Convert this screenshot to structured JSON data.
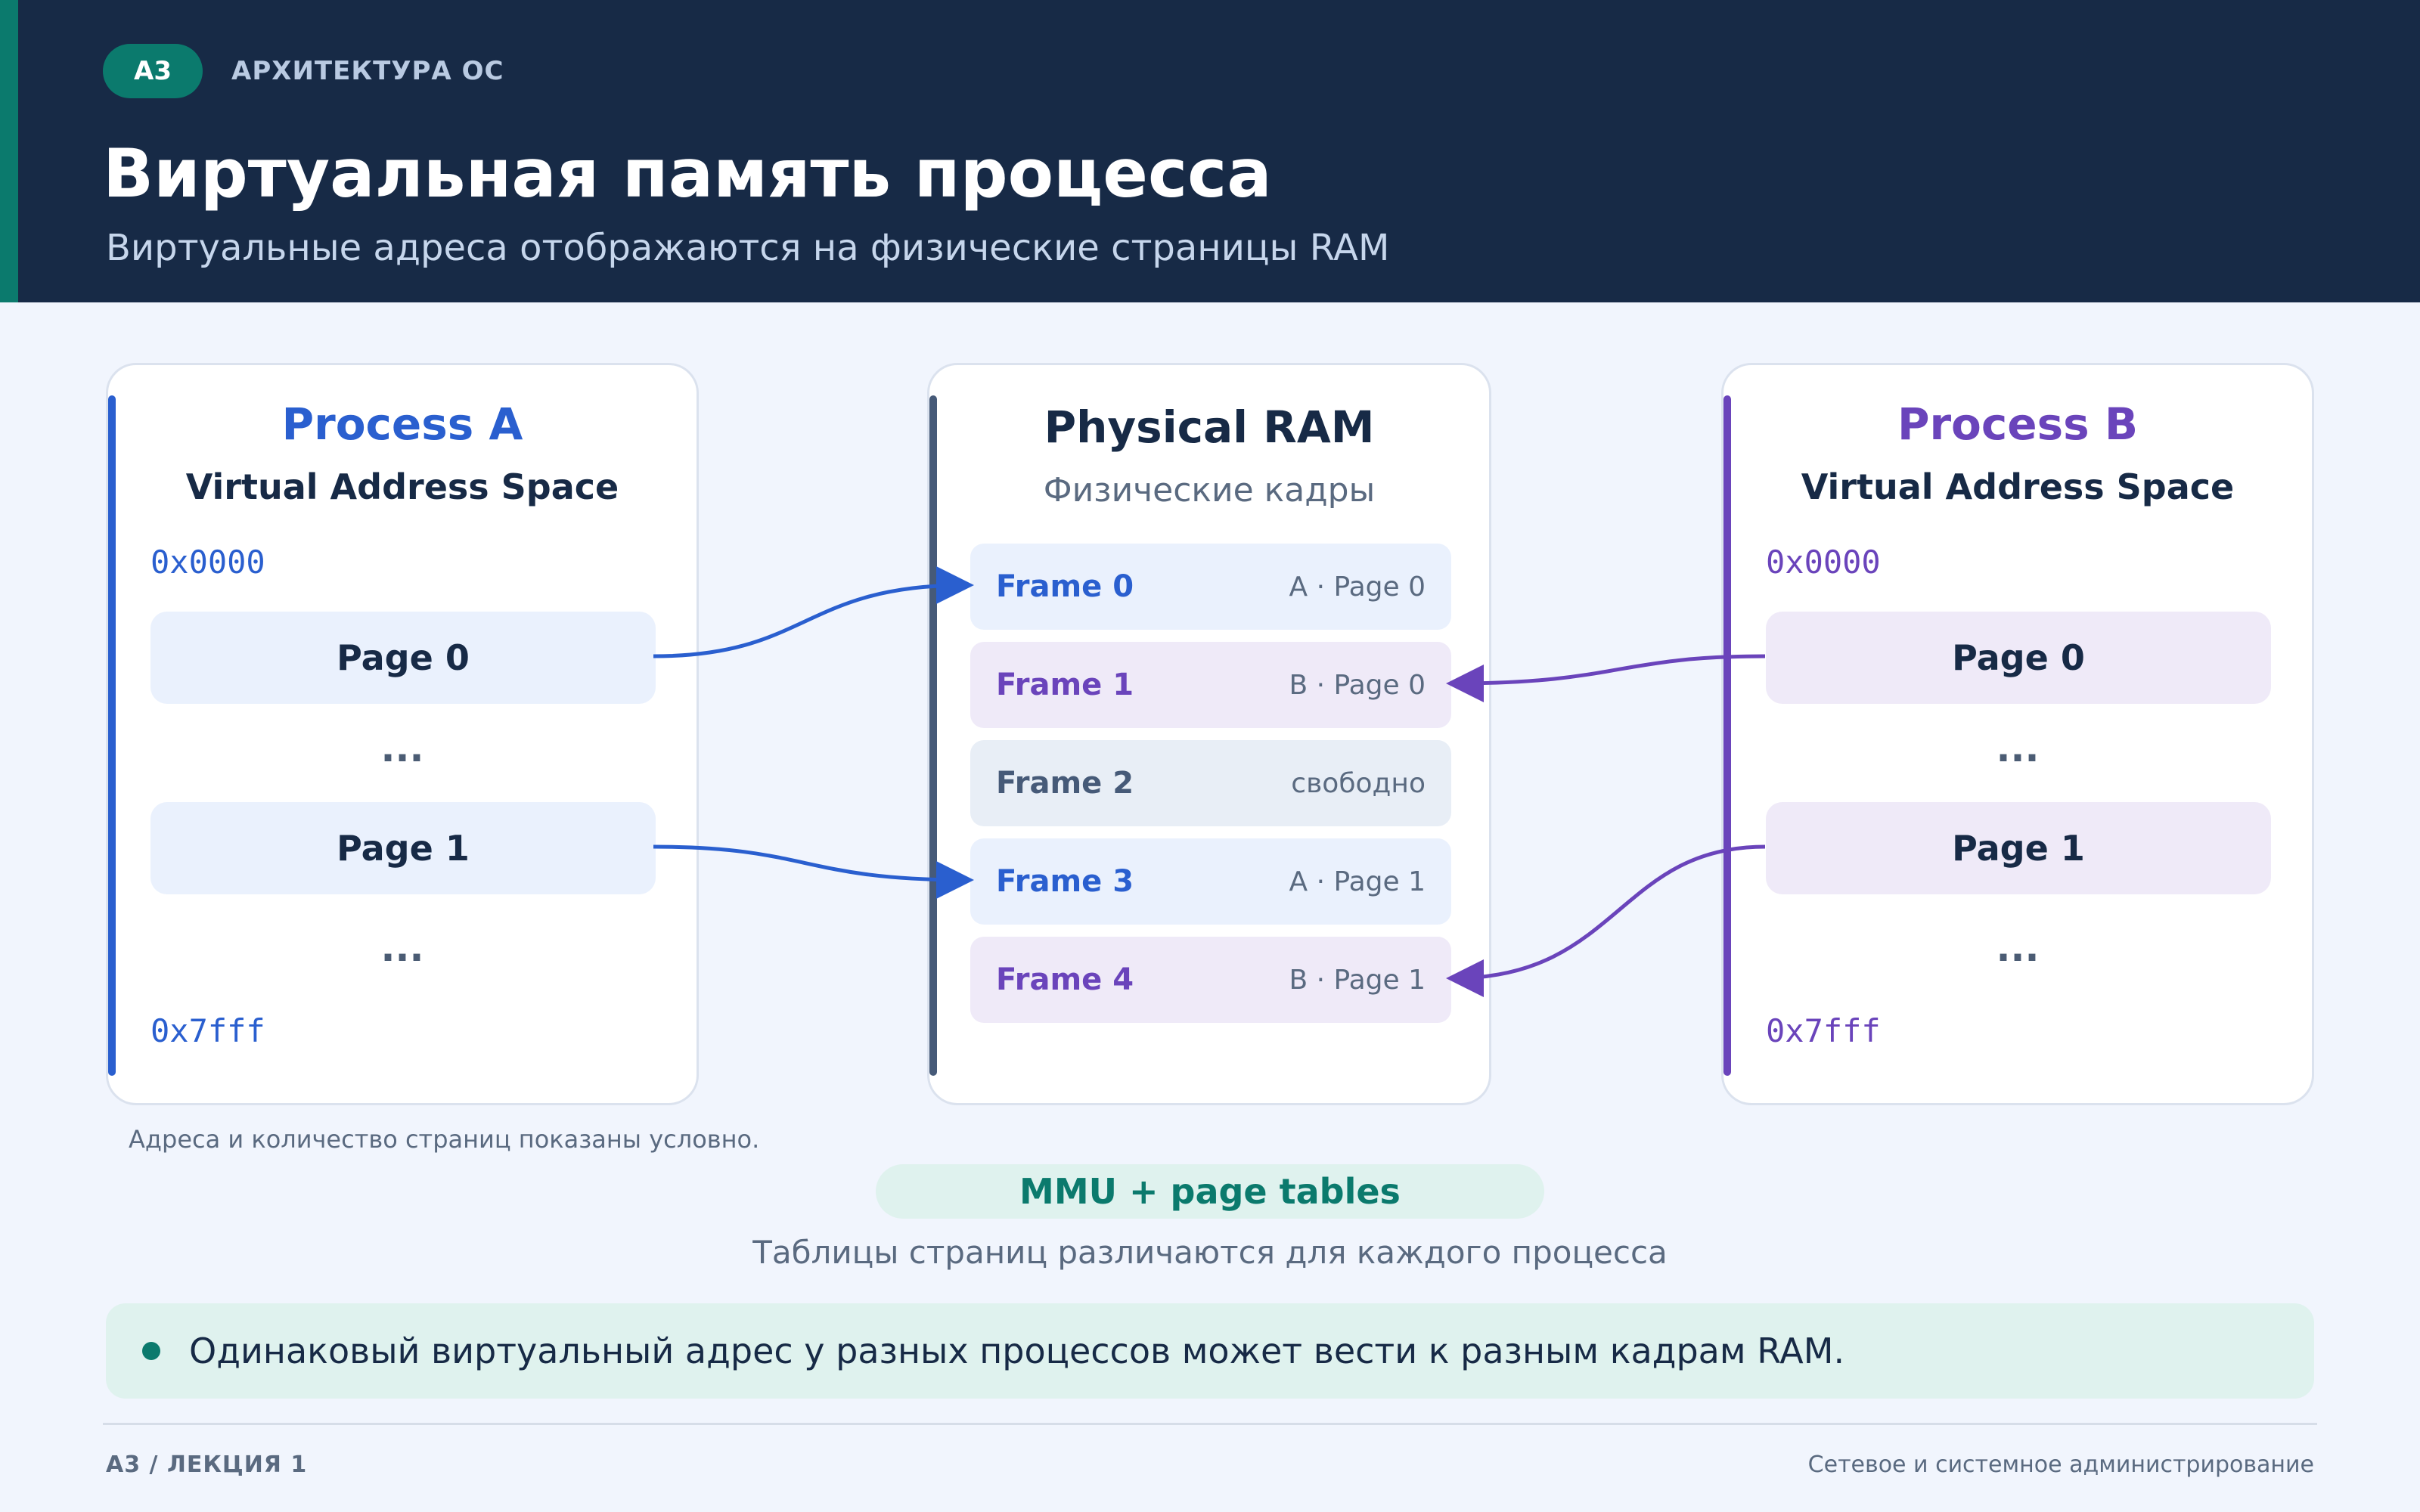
{
  "header": {
    "badge": "A3",
    "kicker": "АРХИТЕКТУРА ОС",
    "title": "Виртуальная память процесса",
    "subtitle": "Виртуальные адреса отображаются на физические страницы RAM"
  },
  "process_a": {
    "title": "Process A",
    "subtitle": "Virtual Address Space",
    "addr_start": "0x0000",
    "addr_end": "0x7fff",
    "pages": [
      "Page 0",
      "Page 1"
    ],
    "ellipsis": "...",
    "color": "#2a5fcf"
  },
  "ram": {
    "title": "Physical RAM",
    "subtitle": "Физические кадры",
    "frames": [
      {
        "name": "Frame 0",
        "map": "A · Page 0"
      },
      {
        "name": "Frame 1",
        "map": "B · Page 0"
      },
      {
        "name": "Frame 2",
        "map": "свободно"
      },
      {
        "name": "Frame 3",
        "map": "A · Page 1"
      },
      {
        "name": "Frame 4",
        "map": "B · Page 1"
      }
    ],
    "color": "#465a78"
  },
  "process_b": {
    "title": "Process B",
    "subtitle": "Virtual Address Space",
    "addr_start": "0x0000",
    "addr_end": "0x7fff",
    "pages": [
      "Page 0",
      "Page 1"
    ],
    "ellipsis": "...",
    "color": "#6a44bb"
  },
  "mappings": [
    {
      "process": "A",
      "page": "Page 0",
      "frame": "Frame 0"
    },
    {
      "process": "A",
      "page": "Page 1",
      "frame": "Frame 3"
    },
    {
      "process": "B",
      "page": "Page 0",
      "frame": "Frame 1"
    },
    {
      "process": "B",
      "page": "Page 1",
      "frame": "Frame 4"
    }
  ],
  "note": "Адреса и количество страниц показаны условно.",
  "mmu": {
    "label": "MMU + page tables",
    "subtitle": "Таблицы страниц различаются для каждого процесса"
  },
  "callout": "Одинаковый виртуальный адрес у разных процессов может вести к разным кадрам RAM.",
  "footer": {
    "left": "A3 / ЛЕКЦИЯ 1",
    "right": "Сетевое и системное администрирование"
  }
}
